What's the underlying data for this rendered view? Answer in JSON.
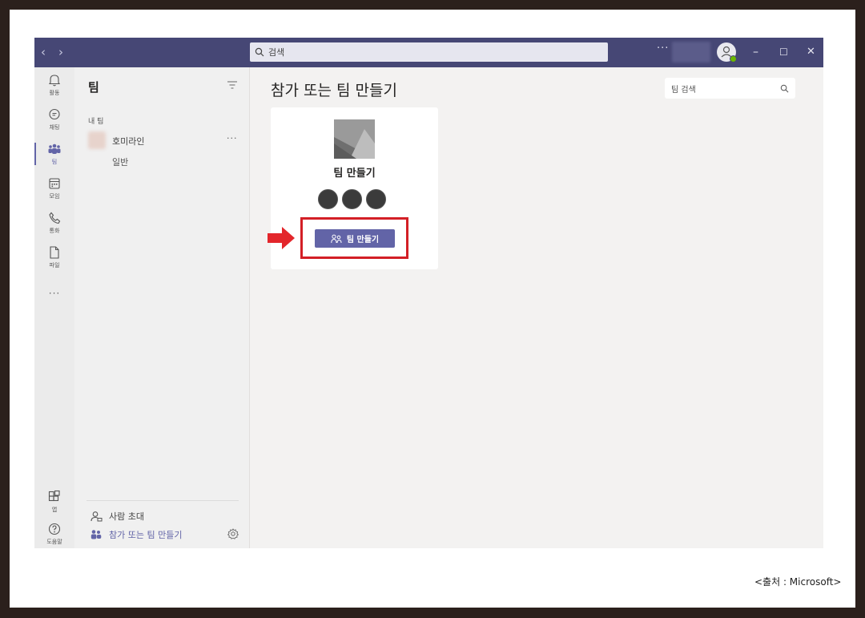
{
  "titlebar": {
    "search_label": "검색",
    "more": "···",
    "back": "‹",
    "forward": "›",
    "minimize": "–",
    "maximize": "☐",
    "close": "✕"
  },
  "rail": {
    "items": [
      {
        "label": "활동",
        "icon": "bell-icon"
      },
      {
        "label": "채팅",
        "icon": "chat-icon"
      },
      {
        "label": "팀",
        "icon": "teams-icon"
      },
      {
        "label": "모임",
        "icon": "calendar-icon"
      },
      {
        "label": "통화",
        "icon": "phone-icon"
      },
      {
        "label": "파일",
        "icon": "file-icon"
      }
    ],
    "more": "···",
    "apps_label": "앱",
    "help_label": "도움말"
  },
  "panel": {
    "title": "팀",
    "section_label": "내 팀",
    "team_name": "호미라인",
    "team_more": "···",
    "channel": "일반",
    "invite_label": "사람 초대",
    "join_label": "참가 또는 팀 만들기"
  },
  "main": {
    "title": "참가 또는 팀 만들기",
    "team_search_placeholder": "팀 검색",
    "card_title": "팀 만들기",
    "create_button_label": "팀 만들기"
  },
  "credit": "<출처 : Microsoft>",
  "colors": {
    "titlebar": "#464775",
    "accent": "#6264a7",
    "highlight": "#d31f26",
    "online": "#6bb700"
  }
}
